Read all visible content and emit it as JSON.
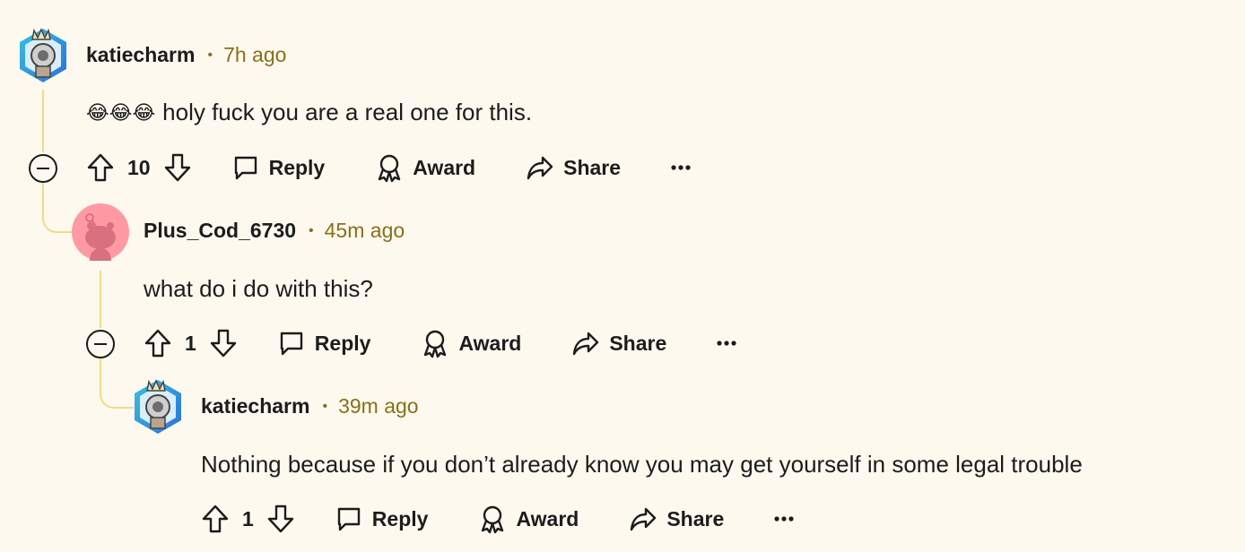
{
  "comments": [
    {
      "username": "katiecharm",
      "time": "7h ago",
      "emoji": [
        "😂",
        "😂",
        "😂"
      ],
      "text": "holy fuck you are a real one for this.",
      "votes": "10",
      "avatar_icon": "snoo-avatar-robot-crown"
    },
    {
      "username": "Plus_Cod_6730",
      "time": "45m ago",
      "text": "what do i do with this?",
      "votes": "1",
      "avatar_icon": "default-snoo-avatar"
    },
    {
      "username": "katiecharm",
      "time": "39m ago",
      "text": "Nothing because if you don’t already know you may get yourself in some legal trouble",
      "votes": "1",
      "avatar_icon": "snoo-avatar-robot-crown"
    }
  ],
  "actions": {
    "reply": "Reply",
    "award": "Award",
    "share": "Share",
    "more": "more-dots-icon"
  },
  "colors": {
    "background": "#fdf9ee",
    "thread_line": "#f3dc82",
    "meta": "#8b6e19",
    "default_avatar": "#ff9aa5"
  }
}
